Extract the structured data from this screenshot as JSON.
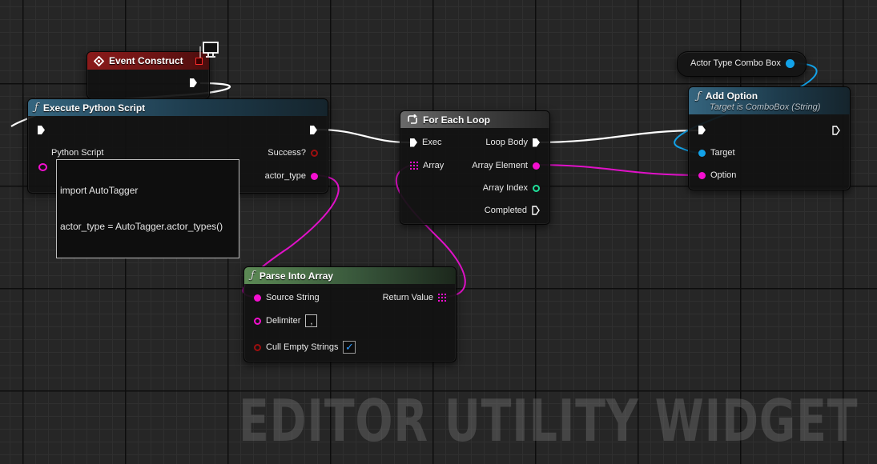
{
  "watermark": "EDITOR UTILITY WIDGET",
  "nodes": {
    "event_construct": {
      "title": "Event Construct"
    },
    "execute_python": {
      "title": "Execute Python Script",
      "python_script_label": "Python Script",
      "script_line1": "import AutoTagger",
      "script_line2": "actor_type = AutoTagger.actor_types()",
      "success_label": "Success?",
      "actor_type_label": "actor_type"
    },
    "for_each_loop": {
      "title": "For Each Loop",
      "exec_label": "Exec",
      "array_label": "Array",
      "loop_body_label": "Loop Body",
      "array_element_label": "Array Element",
      "array_index_label": "Array Index",
      "completed_label": "Completed"
    },
    "parse_into_array": {
      "title": "Parse Into Array",
      "source_string_label": "Source String",
      "delimiter_label": "Delimiter",
      "delimiter_value": ",",
      "cull_empty_label": "Cull Empty Strings",
      "cull_empty_checked": true,
      "return_value_label": "Return Value"
    },
    "actor_type_combo_box": {
      "title": "Actor Type Combo Box"
    },
    "add_option": {
      "title": "Add Option",
      "subtitle": "Target is ComboBox (String)",
      "target_label": "Target",
      "option_label": "Option"
    }
  },
  "colors": {
    "exec_wire": "#ffffff",
    "string_wire": "#e011c8",
    "object_wire": "#12a2e8",
    "string_pin": "#f40fd0",
    "object_pin": "#12a2e8",
    "int_pin": "#1fe09a",
    "bool_pin": "#9c0f0f"
  },
  "icons": {
    "function": "function-f-icon",
    "event": "event-diamond-icon",
    "loop": "loop-icon",
    "editor_only": "monitor-icon"
  }
}
